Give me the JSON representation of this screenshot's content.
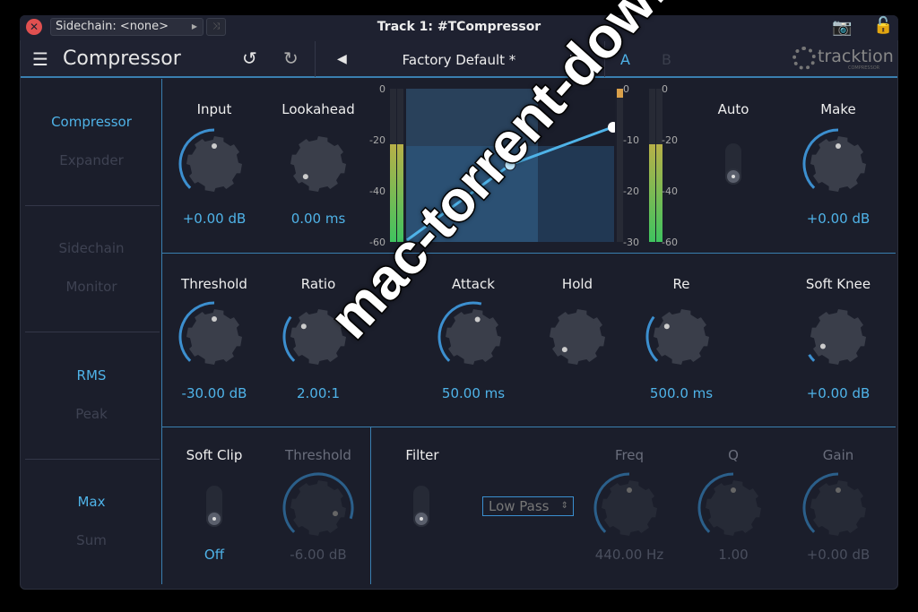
{
  "titlebar": {
    "sidechain": "Sidechain: <none>",
    "title": "Track 1: #TCompressor"
  },
  "toolbar": {
    "plugin_name": "Compressor",
    "preset": "Factory Default *",
    "a": "A",
    "b": "B",
    "brand": "tracktion",
    "brand_sub": "COMPRESSOR"
  },
  "sidebar": {
    "items": [
      {
        "label": "Compressor",
        "active": true
      },
      {
        "label": "Expander",
        "active": false
      },
      {
        "label": "Sidechain",
        "active": false
      },
      {
        "label": "Monitor",
        "active": false
      },
      {
        "label": "RMS",
        "active": true
      },
      {
        "label": "Peak",
        "active": false
      },
      {
        "label": "Max",
        "active": true
      },
      {
        "label": "Sum",
        "active": false
      }
    ]
  },
  "knobs": {
    "input": {
      "label": "Input",
      "value": "+0.00 dB",
      "level": 0.5
    },
    "lookahead": {
      "label": "Lookahead",
      "value": "0.00 ms",
      "level": 0.0
    },
    "makeup": {
      "label": "Make",
      "value": "+0.00 dB",
      "level": 0.5
    },
    "threshold": {
      "label": "Threshold",
      "value": "-30.00 dB",
      "level": 0.5
    },
    "ratio": {
      "label": "Ratio",
      "value": "2.00:1",
      "level": 0.3
    },
    "attack": {
      "label": "Attack",
      "value": "50.00 ms",
      "level": 0.55
    },
    "hold": {
      "label": "Hold",
      "value": "",
      "level": 0.0
    },
    "release": {
      "label": "Re",
      "value": "500.0 ms",
      "level": 0.3
    },
    "softknee": {
      "label": "Soft Knee",
      "value": "+0.00 dB",
      "level": 0.05
    },
    "sc_threshold": {
      "label": "Threshold",
      "value": "-6.00 dB",
      "level": 0.9
    },
    "freq": {
      "label": "Freq",
      "value": "440.00 Hz",
      "level": 0.5
    },
    "q": {
      "label": "Q",
      "value": "1.00",
      "level": 0.5
    },
    "gain": {
      "label": "Gain",
      "value": "+0.00 dB",
      "level": 0.5
    }
  },
  "auto": {
    "label": "Auto"
  },
  "softclip": {
    "label": "Soft Clip",
    "value": "Off"
  },
  "filter": {
    "label": "Filter",
    "type": "Low Pass"
  },
  "graph": {
    "left_ticks": [
      "0",
      "-20",
      "-40",
      "-60"
    ],
    "gr_ticks": [
      "0",
      "-10",
      "-20",
      "-30"
    ],
    "right_ticks": [
      "0",
      "-20",
      "-40",
      "-60"
    ],
    "input_level_db": -22,
    "output_level_db": -22
  },
  "watermark": "mac-torrent-download.net",
  "colors": {
    "accent": "#4fb3e8",
    "bg": "#1b1e2b"
  }
}
